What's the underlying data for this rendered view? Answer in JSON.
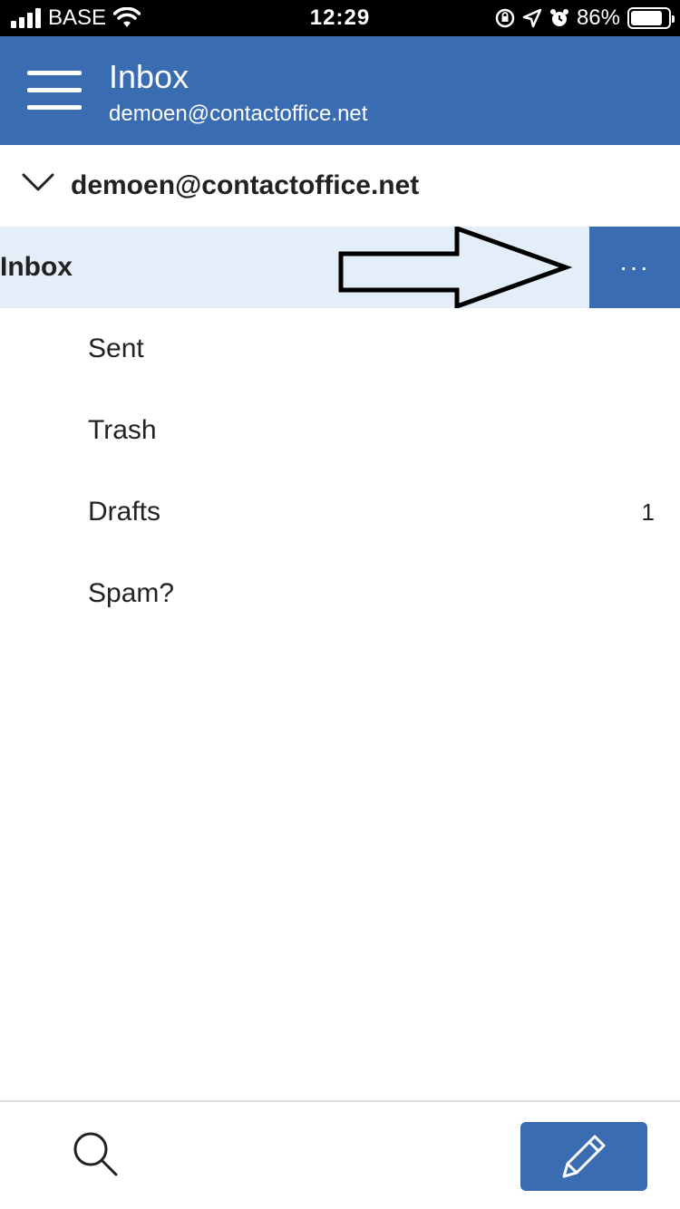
{
  "status_bar": {
    "carrier": "BASE",
    "time": "12:29",
    "battery_percent": "86%",
    "battery_level": 0.86,
    "icons": [
      "signal-icon",
      "wifi-icon",
      "orientation-lock-icon",
      "location-icon",
      "alarm-icon",
      "battery-icon"
    ]
  },
  "header": {
    "title": "Inbox",
    "subtitle": "demoen@contactoffice.net",
    "color": "#3a6cb1"
  },
  "account": {
    "label": "demoen@contactoffice.net"
  },
  "folders": [
    {
      "label": "Inbox",
      "selected": true,
      "more_label": "···"
    },
    {
      "label": "Sent"
    },
    {
      "label": "Trash"
    },
    {
      "label": "Drafts",
      "count": "1"
    },
    {
      "label": "Spam?"
    }
  ],
  "colors": {
    "accent": "#3a6cb1",
    "selected_row": "#e3eef9"
  }
}
